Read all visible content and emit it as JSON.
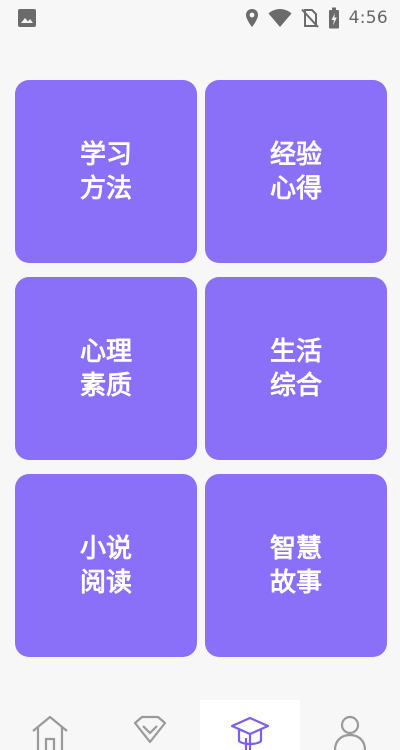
{
  "status_bar": {
    "time": "4:56",
    "icons": [
      "image-notification-icon",
      "location-icon",
      "wifi-icon",
      "no-sim-icon",
      "battery-charging-icon"
    ]
  },
  "categories": [
    {
      "line1": "学习",
      "line2": "方法"
    },
    {
      "line1": "经验",
      "line2": "心得"
    },
    {
      "line1": "心理",
      "line2": "素质"
    },
    {
      "line1": "生活",
      "line2": "综合"
    },
    {
      "line1": "小说",
      "line2": "阅读"
    },
    {
      "line1": "智慧",
      "line2": "故事"
    }
  ],
  "bottom_nav": {
    "items": [
      "home-icon",
      "diamond-icon",
      "graduation-cap-icon",
      "profile-icon"
    ],
    "active_index": 2
  },
  "colors": {
    "card": "#8a6ff8",
    "card_text": "#ffffff",
    "background": "#f7f7f7",
    "nav_icon": "#9a9a9a",
    "nav_icon_active": "#7d5cf0"
  }
}
